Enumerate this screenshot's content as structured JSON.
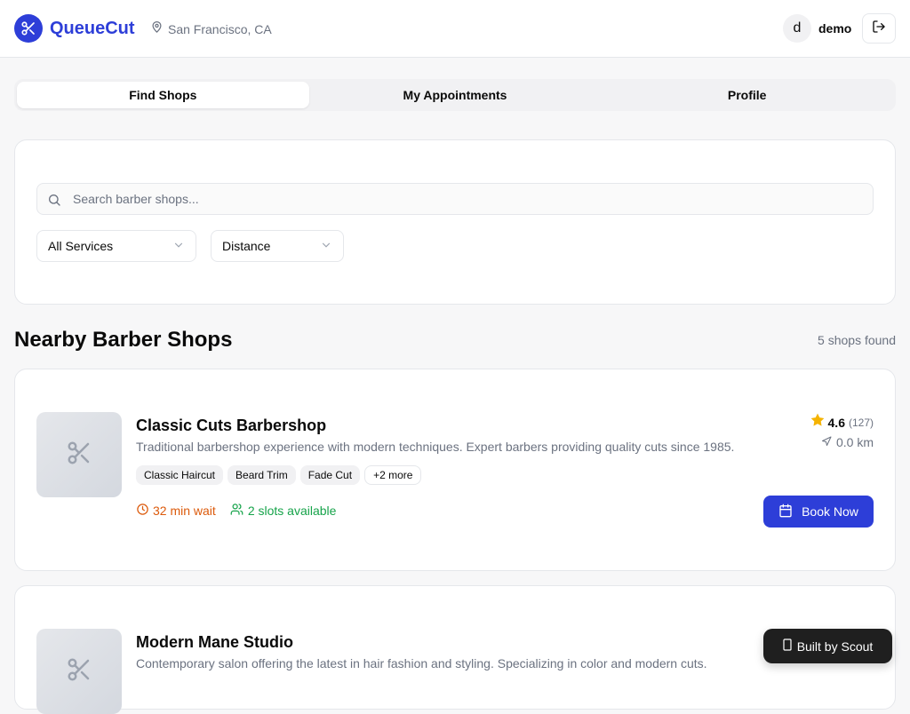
{
  "header": {
    "brand": "QueueCut",
    "location": "San Francisco, CA",
    "avatar_initial": "d",
    "username": "demo",
    "brand_color": "#2d3ed8"
  },
  "tabs": [
    {
      "label": "Find Shops",
      "active": true
    },
    {
      "label": "My Appointments",
      "active": false
    },
    {
      "label": "Profile",
      "active": false
    }
  ],
  "filters": {
    "search_placeholder": "Search barber shops...",
    "search_value": "",
    "services_selected": "All Services",
    "sort_selected": "Distance"
  },
  "section": {
    "title": "Nearby Barber Shops",
    "count_text": "5 shops found"
  },
  "shops": [
    {
      "name": "Classic Cuts Barbershop",
      "description": "Traditional barbershop experience with modern techniques. Expert barbers providing quality cuts since 1985.",
      "services": [
        "Classic Haircut",
        "Beard Trim",
        "Fade Cut"
      ],
      "more_services": "+2 more",
      "wait": "32 min wait",
      "slots": "2 slots available",
      "rating": "4.6",
      "reviews": "(127)",
      "distance": "0.0 km",
      "book_label": "Book Now"
    },
    {
      "name": "Modern Mane Studio",
      "description": "Contemporary salon offering the latest in hair fashion and styling. Specializing in color and modern cuts."
    }
  ],
  "badge": {
    "label": "Built by Scout"
  },
  "colors": {
    "wait": "#dc5a0b",
    "slots": "#16a34a",
    "star": "#f5b301"
  }
}
